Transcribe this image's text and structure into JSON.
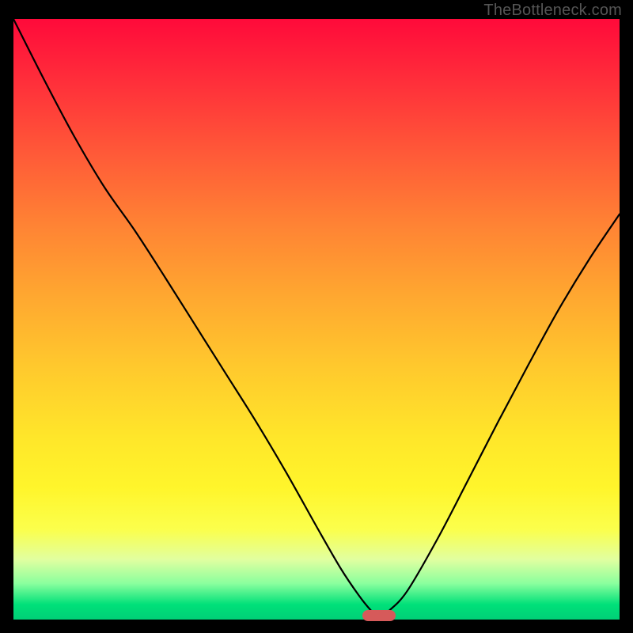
{
  "watermark": "TheBottleneck.com",
  "marker": {
    "color": "#d65a5a",
    "x_frac": 0.603,
    "y_frac": 0.994
  },
  "chart_data": {
    "type": "line",
    "title": "",
    "xlabel": "",
    "ylabel": "",
    "xlim": [
      0,
      1
    ],
    "ylim": [
      0,
      1
    ],
    "grid": false,
    "legend": false,
    "series": [
      {
        "name": "bottleneck-curve",
        "x": [
          0.0,
          0.05,
          0.1,
          0.15,
          0.2,
          0.25,
          0.3,
          0.35,
          0.4,
          0.45,
          0.5,
          0.54,
          0.57,
          0.59,
          0.603,
          0.62,
          0.65,
          0.7,
          0.75,
          0.8,
          0.85,
          0.9,
          0.95,
          1.0
        ],
        "y": [
          1.0,
          0.9,
          0.805,
          0.72,
          0.648,
          0.57,
          0.49,
          0.41,
          0.33,
          0.245,
          0.155,
          0.085,
          0.04,
          0.015,
          0.004,
          0.015,
          0.048,
          0.135,
          0.232,
          0.33,
          0.425,
          0.517,
          0.6,
          0.675
        ]
      }
    ],
    "annotations": [
      {
        "text": "TheBottleneck.com",
        "position": "top-right"
      }
    ]
  }
}
